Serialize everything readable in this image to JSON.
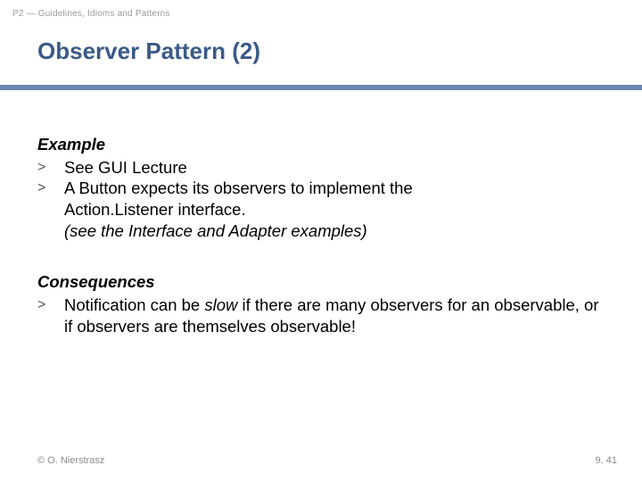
{
  "header": {
    "label": "P2 — Guidelines, Idioms and Patterns"
  },
  "title": "Observer Pattern (2)",
  "sections": {
    "example": {
      "heading": "Example",
      "b1": {
        "mark": ">",
        "text": "See GUI Lecture"
      },
      "b2": {
        "mark": ">",
        "l1": "A Button expects its observers to implement the",
        "l2a": "Action.Listener",
        "l2b": " interface.",
        "l3": "(see the Interface and Adapter examples)"
      }
    },
    "consequences": {
      "heading": "Consequences",
      "b1": {
        "mark": ">",
        "p1": "Notification can be ",
        "slow": "slow",
        "p2": " if there are many observers for an observable, or if observers are themselves observable!"
      }
    }
  },
  "footer": {
    "left": "© O. Nierstrasz",
    "right": "9. 41"
  }
}
